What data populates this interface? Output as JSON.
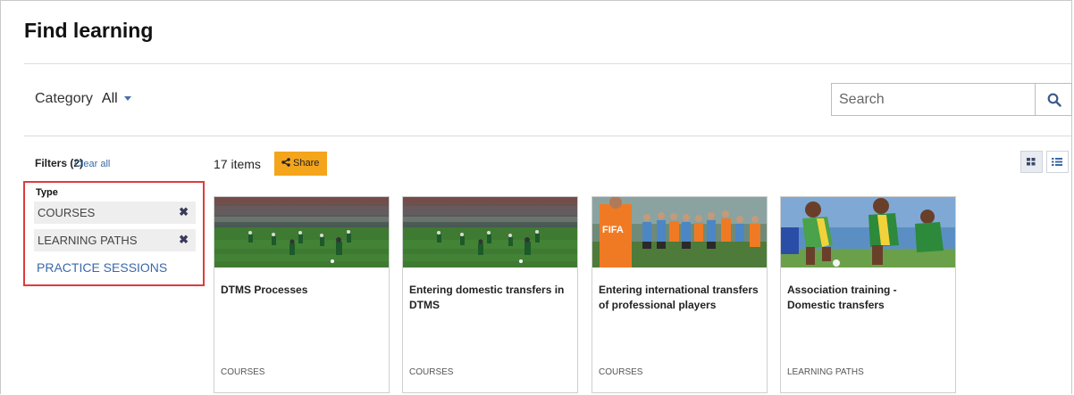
{
  "page": {
    "title": "Find learning"
  },
  "category": {
    "label": "Category",
    "value": "All"
  },
  "search": {
    "placeholder": "Search"
  },
  "filters": {
    "heading": "Filters (2)",
    "clear_all": "Clear all",
    "type_label": "Type",
    "chips": [
      "COURSES",
      "LEARNING PATHS"
    ],
    "practice": "PRACTICE SESSIONS"
  },
  "results": {
    "count": "17 items",
    "share": "Share"
  },
  "cards": [
    {
      "title": "DTMS Processes",
      "type": "COURSES",
      "image": "stadium-training"
    },
    {
      "title": "Entering domestic transfers in DTMS",
      "type": "COURSES",
      "image": "stadium-training"
    },
    {
      "title": "Entering international transfers of professional players",
      "type": "COURSES",
      "image": "team-training-fifa"
    },
    {
      "title": "Association training - Domestic transfers",
      "type": "LEARNING PATHS",
      "image": "match-action"
    }
  ],
  "colors": {
    "accent_orange": "#f4a51c",
    "link_blue": "#3b69a8",
    "highlight_red": "#e03b3b"
  },
  "icons": [
    "search-icon",
    "share-icon",
    "remove-icon",
    "grid-view-icon",
    "list-view-icon",
    "caret-down-icon"
  ]
}
